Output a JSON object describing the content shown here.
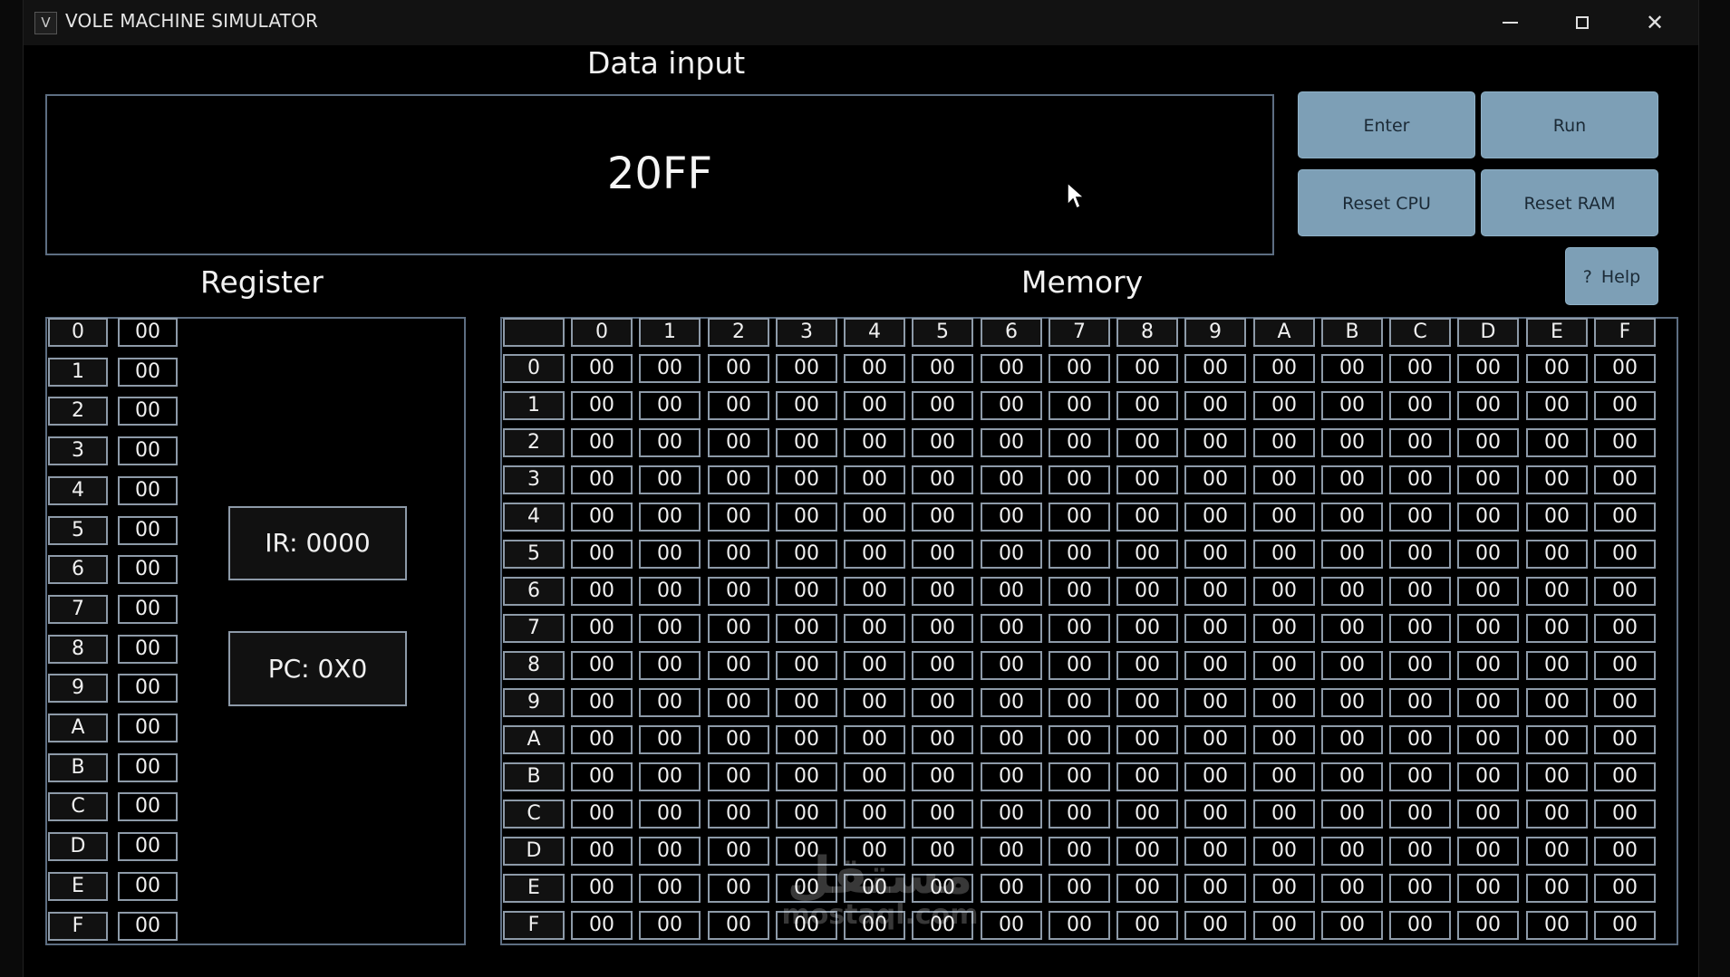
{
  "window": {
    "icon_letter": "V",
    "title": "VOLE MACHINE SIMULATOR",
    "close_glyph": "✕"
  },
  "data_input": {
    "title": "Data input",
    "value": "20FF"
  },
  "buttons": {
    "enter": "Enter",
    "run": "Run",
    "reset_cpu": "Reset CPU",
    "reset_ram": "Reset RAM",
    "help": "Help",
    "help_icon": "?"
  },
  "register": {
    "title": "Register",
    "labels": [
      "0",
      "1",
      "2",
      "3",
      "4",
      "5",
      "6",
      "7",
      "8",
      "9",
      "A",
      "B",
      "C",
      "D",
      "E",
      "F"
    ],
    "values": [
      "00",
      "00",
      "00",
      "00",
      "00",
      "00",
      "00",
      "00",
      "00",
      "00",
      "00",
      "00",
      "00",
      "00",
      "00",
      "00"
    ],
    "ir": "IR: 0000",
    "pc": "PC: 0X0"
  },
  "memory": {
    "title": "Memory",
    "col_headers": [
      "0",
      "1",
      "2",
      "3",
      "4",
      "5",
      "6",
      "7",
      "8",
      "9",
      "A",
      "B",
      "C",
      "D",
      "E",
      "F"
    ],
    "row_headers": [
      "0",
      "1",
      "2",
      "3",
      "4",
      "5",
      "6",
      "7",
      "8",
      "9",
      "A",
      "B",
      "C",
      "D",
      "E",
      "F"
    ],
    "cells": [
      [
        "00",
        "00",
        "00",
        "00",
        "00",
        "00",
        "00",
        "00",
        "00",
        "00",
        "00",
        "00",
        "00",
        "00",
        "00",
        "00"
      ],
      [
        "00",
        "00",
        "00",
        "00",
        "00",
        "00",
        "00",
        "00",
        "00",
        "00",
        "00",
        "00",
        "00",
        "00",
        "00",
        "00"
      ],
      [
        "00",
        "00",
        "00",
        "00",
        "00",
        "00",
        "00",
        "00",
        "00",
        "00",
        "00",
        "00",
        "00",
        "00",
        "00",
        "00"
      ],
      [
        "00",
        "00",
        "00",
        "00",
        "00",
        "00",
        "00",
        "00",
        "00",
        "00",
        "00",
        "00",
        "00",
        "00",
        "00",
        "00"
      ],
      [
        "00",
        "00",
        "00",
        "00",
        "00",
        "00",
        "00",
        "00",
        "00",
        "00",
        "00",
        "00",
        "00",
        "00",
        "00",
        "00"
      ],
      [
        "00",
        "00",
        "00",
        "00",
        "00",
        "00",
        "00",
        "00",
        "00",
        "00",
        "00",
        "00",
        "00",
        "00",
        "00",
        "00"
      ],
      [
        "00",
        "00",
        "00",
        "00",
        "00",
        "00",
        "00",
        "00",
        "00",
        "00",
        "00",
        "00",
        "00",
        "00",
        "00",
        "00"
      ],
      [
        "00",
        "00",
        "00",
        "00",
        "00",
        "00",
        "00",
        "00",
        "00",
        "00",
        "00",
        "00",
        "00",
        "00",
        "00",
        "00"
      ],
      [
        "00",
        "00",
        "00",
        "00",
        "00",
        "00",
        "00",
        "00",
        "00",
        "00",
        "00",
        "00",
        "00",
        "00",
        "00",
        "00"
      ],
      [
        "00",
        "00",
        "00",
        "00",
        "00",
        "00",
        "00",
        "00",
        "00",
        "00",
        "00",
        "00",
        "00",
        "00",
        "00",
        "00"
      ],
      [
        "00",
        "00",
        "00",
        "00",
        "00",
        "00",
        "00",
        "00",
        "00",
        "00",
        "00",
        "00",
        "00",
        "00",
        "00",
        "00"
      ],
      [
        "00",
        "00",
        "00",
        "00",
        "00",
        "00",
        "00",
        "00",
        "00",
        "00",
        "00",
        "00",
        "00",
        "00",
        "00",
        "00"
      ],
      [
        "00",
        "00",
        "00",
        "00",
        "00",
        "00",
        "00",
        "00",
        "00",
        "00",
        "00",
        "00",
        "00",
        "00",
        "00",
        "00"
      ],
      [
        "00",
        "00",
        "00",
        "00",
        "00",
        "00",
        "00",
        "00",
        "00",
        "00",
        "00",
        "00",
        "00",
        "00",
        "00",
        "00"
      ],
      [
        "00",
        "00",
        "00",
        "00",
        "00",
        "00",
        "00",
        "00",
        "00",
        "00",
        "00",
        "00",
        "00",
        "00",
        "00",
        "00"
      ],
      [
        "00",
        "00",
        "00",
        "00",
        "00",
        "00",
        "00",
        "00",
        "00",
        "00",
        "00",
        "00",
        "00",
        "00",
        "00",
        "00"
      ]
    ]
  },
  "watermark": {
    "arabic": "مستقل",
    "latin": "mostaql.com"
  },
  "colors": {
    "button_bg": "#7d9fb6",
    "panel_border": "#5d6e82",
    "cell_border": "#8d9aa8",
    "background": "#000000"
  }
}
